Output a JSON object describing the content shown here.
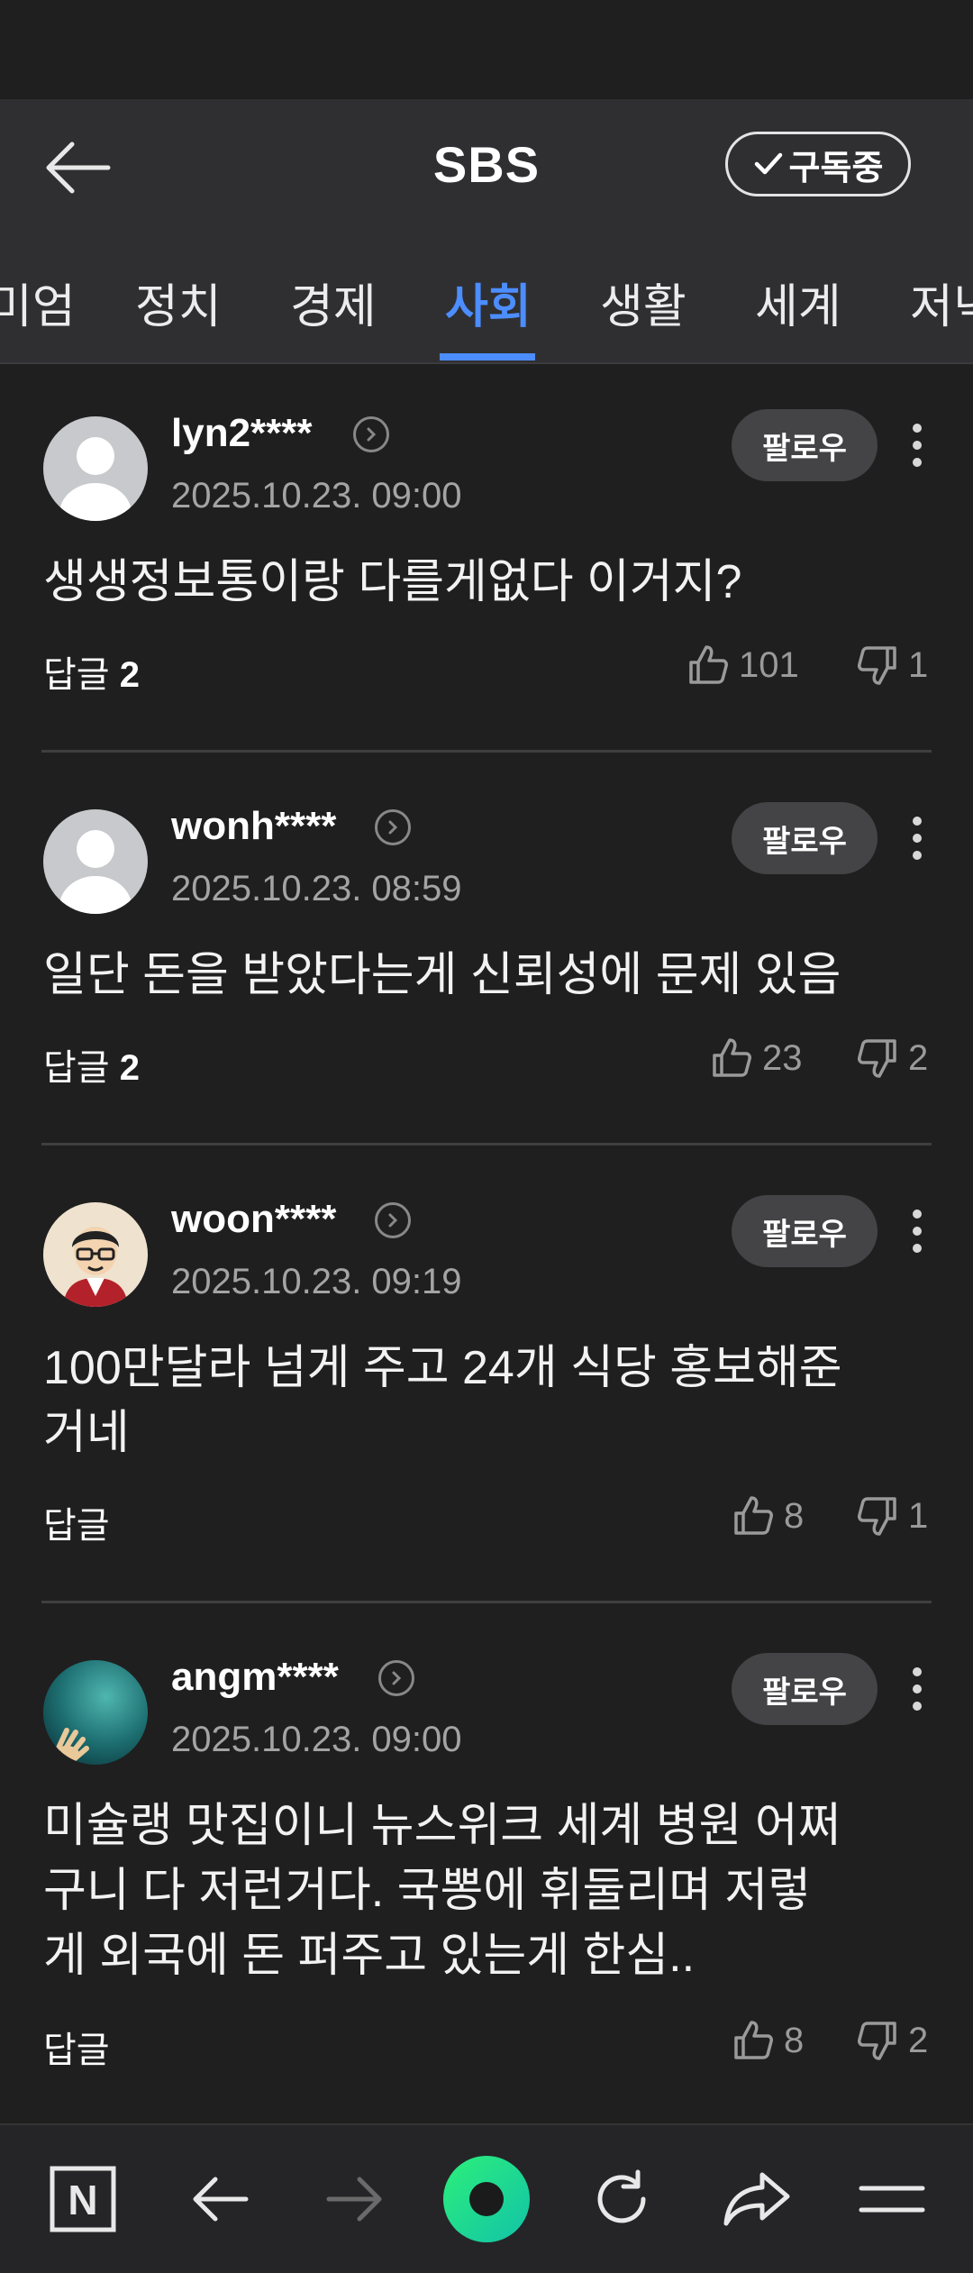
{
  "header": {
    "title": "SBS",
    "subscribe_label": "구독중"
  },
  "tabs": [
    {
      "label": "미엄"
    },
    {
      "label": "정치"
    },
    {
      "label": "경제"
    },
    {
      "label": "사회",
      "active": true
    },
    {
      "label": "생활"
    },
    {
      "label": "세계"
    },
    {
      "label": "저녁"
    }
  ],
  "comments": [
    {
      "username": "lyn2****",
      "timestamp": "2025.10.23. 09:00",
      "text": "생생정보통이랑 다를게없다 이거지?",
      "reply_label": "답글",
      "reply_count": "2",
      "likes": "101",
      "dislikes": "1",
      "follow_label": "팔로우",
      "avatar": "default-avatar"
    },
    {
      "username": "wonh****",
      "timestamp": "2025.10.23. 08:59",
      "text": "일단 돈을 받았다는게 신뢰성에 문제 있음",
      "reply_label": "답글",
      "reply_count": "2",
      "likes": "23",
      "dislikes": "2",
      "follow_label": "팔로우",
      "avatar": "default-avatar"
    },
    {
      "username": "woon****",
      "timestamp": "2025.10.23. 09:19",
      "text_lines": [
        "100만달라 넘게 주고 24개 식당 홍보해준",
        "거네"
      ],
      "reply_label": "답글",
      "likes": "8",
      "dislikes": "1",
      "follow_label": "팔로우",
      "avatar": "cartoon-man-avatar"
    },
    {
      "username": "angm****",
      "timestamp": "2025.10.23. 09:00",
      "text_lines": [
        "미슐랭 맛집이니 뉴스위크 세계 병원 어쩌",
        "구니 다 저런거다. 국뽕에 휘둘리며 저렇",
        "게 외국에 돈 퍼주고 있는게 한심.."
      ],
      "reply_label": "답글",
      "likes": "8",
      "dislikes": "2",
      "follow_label": "팔로우",
      "avatar": "underwater-hand-avatar"
    }
  ],
  "bottom_nav": {
    "home_letter": "N",
    "icons": [
      "naver-home-icon",
      "back-arrow-icon",
      "forward-arrow-icon",
      "green-dot-icon",
      "refresh-icon",
      "share-icon",
      "menu-icon"
    ]
  },
  "colors": {
    "accent": "#4c8dff",
    "background": "#1f1f1f",
    "header": "#2f2f32",
    "green": "#19d28a"
  }
}
